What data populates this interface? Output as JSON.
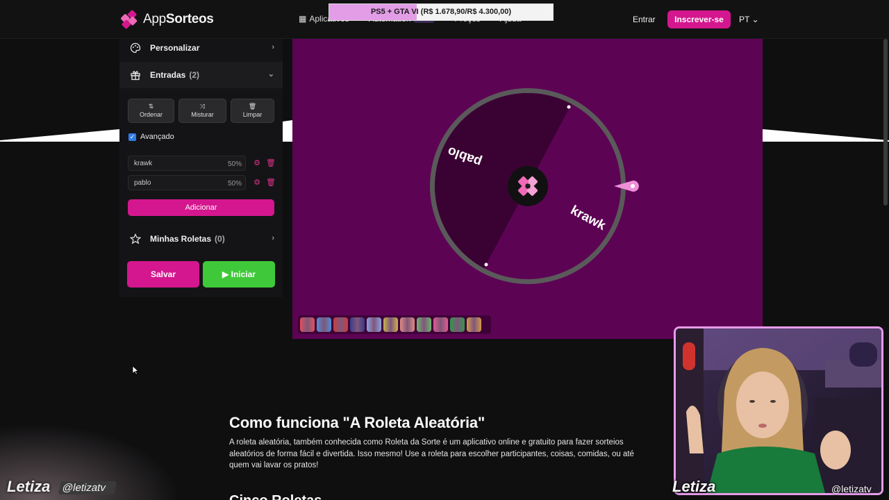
{
  "brand": {
    "prefix": "App",
    "name": "Sorteos"
  },
  "nav": {
    "aplicativos": "Aplicativos",
    "automation": "Automation",
    "new_badge": "NEW",
    "precos": "Preços",
    "ajuda": "Ajuda",
    "entrar": "Entrar",
    "inscrever": "Inscrever-se",
    "lang": "PT"
  },
  "goal": {
    "text": "PS5 + GTA VI (R$ 1.678,90/R$ 4.300,00)",
    "current": 1678.9,
    "target": 4300.0,
    "fill_color": "#e29de6"
  },
  "sidebar": {
    "personalizar": "Personalizar",
    "entradas": {
      "label": "Entradas",
      "count": "(2)"
    },
    "tools": {
      "ordenar": "Ordenar",
      "misturar": "Misturar",
      "limpar": "Limpar"
    },
    "avancado": "Avançado",
    "entries": [
      {
        "name": "krawk",
        "pct": "50%"
      },
      {
        "name": "pablo",
        "pct": "50%"
      }
    ],
    "adicionar": "Adicionar",
    "minhas": {
      "label": "Minhas Roletas",
      "count": "(0)"
    },
    "salvar": "Salvar",
    "iniciar": "Iniciar"
  },
  "wheel": {
    "segments": [
      {
        "label": "pablo",
        "color": "#3a0233"
      },
      {
        "label": "krawk",
        "color": "#5d0354"
      }
    ],
    "rim_color": "#5a5a5a",
    "pointer_color": "#ee8fd8",
    "palette": [
      "#e0525b",
      "#4f8fd6",
      "#c83d3d",
      "#3a3a8a",
      "#8da3e0",
      "#c7b34a",
      "#e08a82",
      "#6db56f",
      "#e05b8e",
      "#2f9a4a",
      "#d49a4a"
    ]
  },
  "article": {
    "title": "Como funciona \"A Roleta Aleatória\"",
    "body": "A roleta aleatória, também conhecida como Roleta da Sorte é um aplicativo online e gratuito para fazer sorteios aleatórios de forma fácil e divertida. Isso mesmo! Use a roleta para escolher participantes, coisas, comidas, ou até quem vai lavar os pratos!",
    "next": "Cinco Roletas"
  },
  "stream": {
    "name": "Letiza",
    "handle": "@letizatv"
  }
}
